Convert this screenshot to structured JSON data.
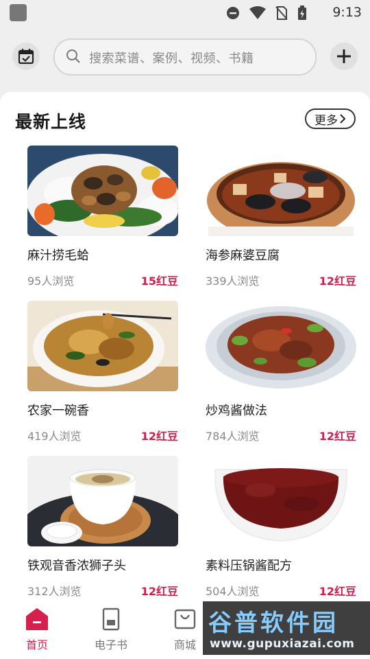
{
  "status_bar": {
    "time": "9:13"
  },
  "header": {
    "search_placeholder": "搜索菜谱、案例、视频、书籍"
  },
  "section": {
    "title": "最新上线",
    "more_label": "更多"
  },
  "recipes": [
    {
      "name": "麻汁捞毛蛤",
      "views": "95人浏览",
      "price": "15红豆"
    },
    {
      "name": "海参麻婆豆腐",
      "views": "339人浏览",
      "price": "12红豆"
    },
    {
      "name": "农家一碗香",
      "views": "419人浏览",
      "price": "12红豆"
    },
    {
      "name": "炒鸡酱做法",
      "views": "784人浏览",
      "price": "12红豆"
    },
    {
      "name": "铁观音香浓狮子头",
      "views": "312人浏览",
      "price": "12红豆"
    },
    {
      "name": "素料压锅酱配方",
      "views": "504人浏览",
      "price": "12红豆"
    }
  ],
  "bottom_nav": [
    {
      "label": "首页",
      "icon": "home-icon",
      "active": true
    },
    {
      "label": "电子书",
      "icon": "ebook-icon",
      "active": false
    },
    {
      "label": "商城",
      "icon": "shop-bag-icon",
      "active": false
    }
  ],
  "watermark": {
    "brand": "谷普软件园",
    "url": "www.gupuxiazai.com"
  },
  "colors": {
    "accent": "#d6204e",
    "price": "#cc1f4e",
    "background": "#efefef"
  }
}
